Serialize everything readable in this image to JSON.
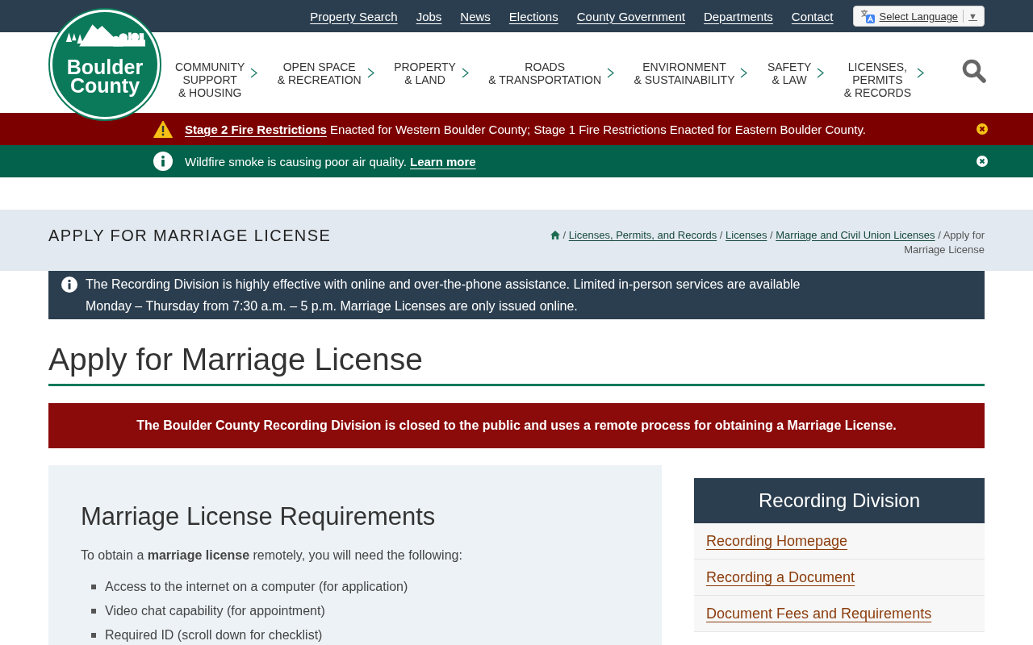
{
  "top_bar": {
    "links": [
      "Property Search",
      "Jobs",
      "News",
      "Elections",
      "County Government",
      "Departments",
      "Contact"
    ],
    "language_select": {
      "label": "Select Language",
      "arrow": "▼"
    }
  },
  "header": {
    "logo": {
      "lines": [
        "Boulder",
        "County"
      ]
    },
    "nav": [
      {
        "lines": [
          "COMMUNITY",
          "SUPPORT",
          "& HOUSING"
        ]
      },
      {
        "lines": [
          "OPEN SPACE",
          "& RECREATION"
        ]
      },
      {
        "lines": [
          "PROPERTY",
          "& LAND"
        ]
      },
      {
        "lines": [
          "ROADS",
          "& TRANSPORTATION"
        ]
      },
      {
        "lines": [
          "ENVIRONMENT",
          "& SUSTAINABILITY"
        ]
      },
      {
        "lines": [
          "SAFETY",
          "& LAW"
        ]
      },
      {
        "lines": [
          "LICENSES,",
          "PERMITS",
          "& RECORDS"
        ]
      }
    ]
  },
  "alerts": [
    {
      "kind": "warning",
      "parts": [
        {
          "kind": "link",
          "text": "Stage 2 Fire Restrictions"
        },
        {
          "kind": "text",
          "text": "Enacted for Western Boulder County; Stage 1 Fire Restrictions Enacted for Eastern Boulder County."
        }
      ]
    },
    {
      "kind": "info",
      "parts": [
        {
          "kind": "text",
          "text": "Wildfire smoke is causing poor air quality."
        },
        {
          "kind": "link",
          "text": "Learn more"
        }
      ]
    }
  ],
  "page_header": {
    "title": "APPLY FOR MARRIAGE LICENSE",
    "breadcrumb": {
      "separator": "/",
      "links": [
        "Licenses, Permits, and Records",
        "Licenses",
        "Marriage and Civil Union Licenses"
      ],
      "current": "Apply for Marriage License"
    }
  },
  "notice": {
    "text": "The Recording Division is highly effective with online and over-the-phone assistance. Limited in-person services are available Monday – Thursday from 7:30 a.m. – 5 p.m. Marriage Licenses are only issued online."
  },
  "heading": "Apply for Marriage License",
  "closure_banner": "The Boulder County Recording Division is closed to the public and uses a remote process for obtaining a Marriage License.",
  "requirements": {
    "title": "Marriage License Requirements",
    "intro": "To obtain a **marriage license** remotely, you will need the following:",
    "items": [
      "Access to the internet on a computer (for application)",
      "Video chat capability (for appointment)",
      "Required ID (scroll down for checklist)"
    ]
  },
  "sidebar": {
    "title": "Recording Division",
    "links": [
      "Recording Homepage",
      "Recording a Document",
      "Document Fees and Requirements"
    ]
  }
}
